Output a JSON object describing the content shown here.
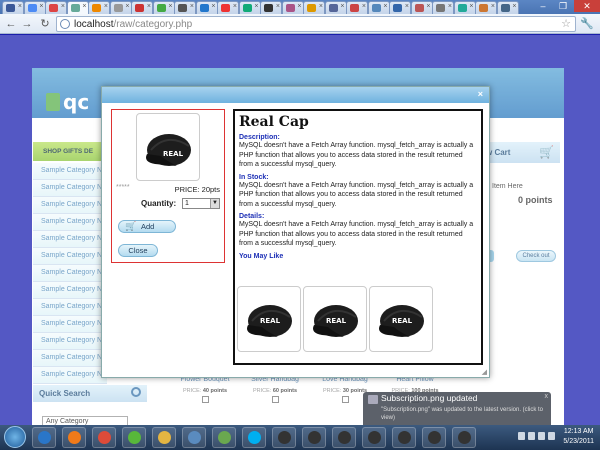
{
  "browser": {
    "tab_count": 24,
    "active_tab_label": "C",
    "url_host": "localhost",
    "url_path": "/raw/category.php",
    "window_controls": [
      "–",
      "❐",
      "✕"
    ]
  },
  "site": {
    "logo_text": "qc",
    "shop_bar_label": "SHOP GIFTS DE",
    "categories": [
      "Sample Category N",
      "Sample Category N",
      "Sample Category N",
      "Sample Category N",
      "Sample Category N",
      "Sample Category N",
      "Sample Category N",
      "Sample Category N",
      "Sample Category N",
      "Sample Category N",
      "Sample Category N",
      "Sample Category N",
      "Sample Category N"
    ],
    "quick_search_title": "Quick Search",
    "category_select_value": "Any Category",
    "cart": {
      "title": "w Cart",
      "item_text": "Item Here",
      "points": "0 points",
      "checkout_label": "Check out"
    },
    "grid_products": [
      {
        "name": "Flower Bouquet",
        "price_label": "PRICE:",
        "price": "40 points"
      },
      {
        "name": "Silver Handbag",
        "price_label": "PRICE:",
        "price": "60 points"
      },
      {
        "name": "Love Handbag",
        "price_label": "PRICE:",
        "price": "30 points"
      },
      {
        "name": "Heart Pillow",
        "price_label": "PRICE:",
        "price": "100 points"
      }
    ]
  },
  "modal": {
    "close_glyph": "×",
    "stars": "*****",
    "price": "PRICE: 20pts",
    "quantity_label": "Quantity:",
    "quantity_value": "1",
    "add_label": "Add",
    "close_label": "Close",
    "title": "Real Cap",
    "cap_text": "REAL",
    "sections": [
      {
        "heading": "Description:",
        "text": "MySQL doesn't have a Fetch Array function. mysql_fetch_array is actually a PHP function that allows you to access data stored in the result returned from a successful mysql_query."
      },
      {
        "heading": "In Stock:",
        "text": "MySQL doesn't have a Fetch Array function. mysql_fetch_array is actually a PHP function that allows you to access data stored in the result returned from a successful mysql_query."
      },
      {
        "heading": "Details:",
        "text": "MySQL doesn't have a Fetch Array function. mysql_fetch_array is actually a PHP function that allows you to access data stored in the result returned from a successful mysql_query."
      }
    ],
    "you_may_like": "You May Like"
  },
  "notification": {
    "title": "Subscription.png updated",
    "message": "\"Subscription.png\" was updated to the latest version. (click to view)",
    "close_glyph": "x"
  },
  "taskbar": {
    "time": "12:13 AM",
    "date": "5/23/2011"
  },
  "colors": {
    "page_background": "#1b20b0",
    "header_gradient_top": "#5aa6d6",
    "accent_green": "#8cc63f",
    "modal_heading_blue": "#1d30b6",
    "left_box_border": "#dd3333"
  }
}
